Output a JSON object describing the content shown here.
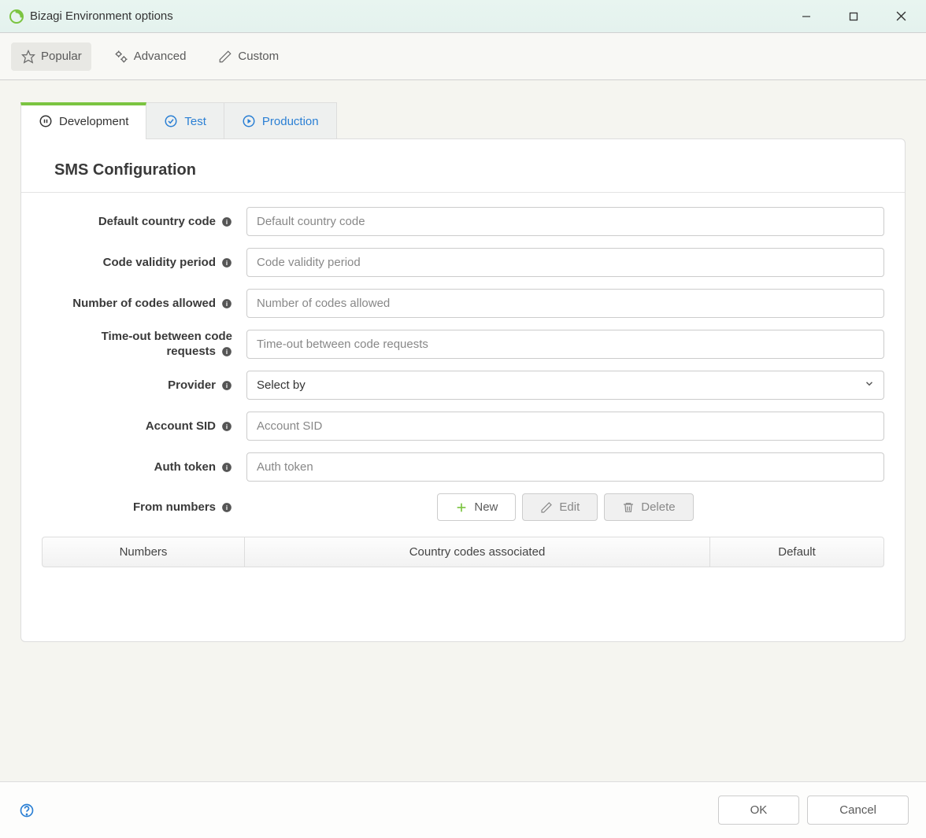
{
  "titlebar": {
    "title": "Bizagi Environment options"
  },
  "mainTabs": {
    "popular": "Popular",
    "advanced": "Advanced",
    "custom": "Custom"
  },
  "envTabs": {
    "development": "Development",
    "test": "Test",
    "production": "Production"
  },
  "section": {
    "title": "SMS Configuration"
  },
  "form": {
    "defaultCountryCode": {
      "label": "Default country code",
      "placeholder": "Default country code"
    },
    "codeValidity": {
      "label": "Code validity period",
      "placeholder": "Code validity period"
    },
    "numCodes": {
      "label": "Number of codes allowed",
      "placeholder": "Number of codes allowed"
    },
    "timeout": {
      "labelLine1": "Time-out between code",
      "labelLine2": "requests",
      "placeholder": "Time-out between code requests"
    },
    "provider": {
      "label": "Provider",
      "selected": "Select by"
    },
    "accountSid": {
      "label": "Account SID",
      "placeholder": "Account SID"
    },
    "authToken": {
      "label": "Auth token",
      "placeholder": "Auth token"
    },
    "fromNumbers": {
      "label": "From numbers"
    }
  },
  "buttons": {
    "new": "New",
    "edit": "Edit",
    "delete": "Delete"
  },
  "table": {
    "colNumbers": "Numbers",
    "colCodes": "Country codes associated",
    "colDefault": "Default"
  },
  "footer": {
    "ok": "OK",
    "cancel": "Cancel"
  }
}
